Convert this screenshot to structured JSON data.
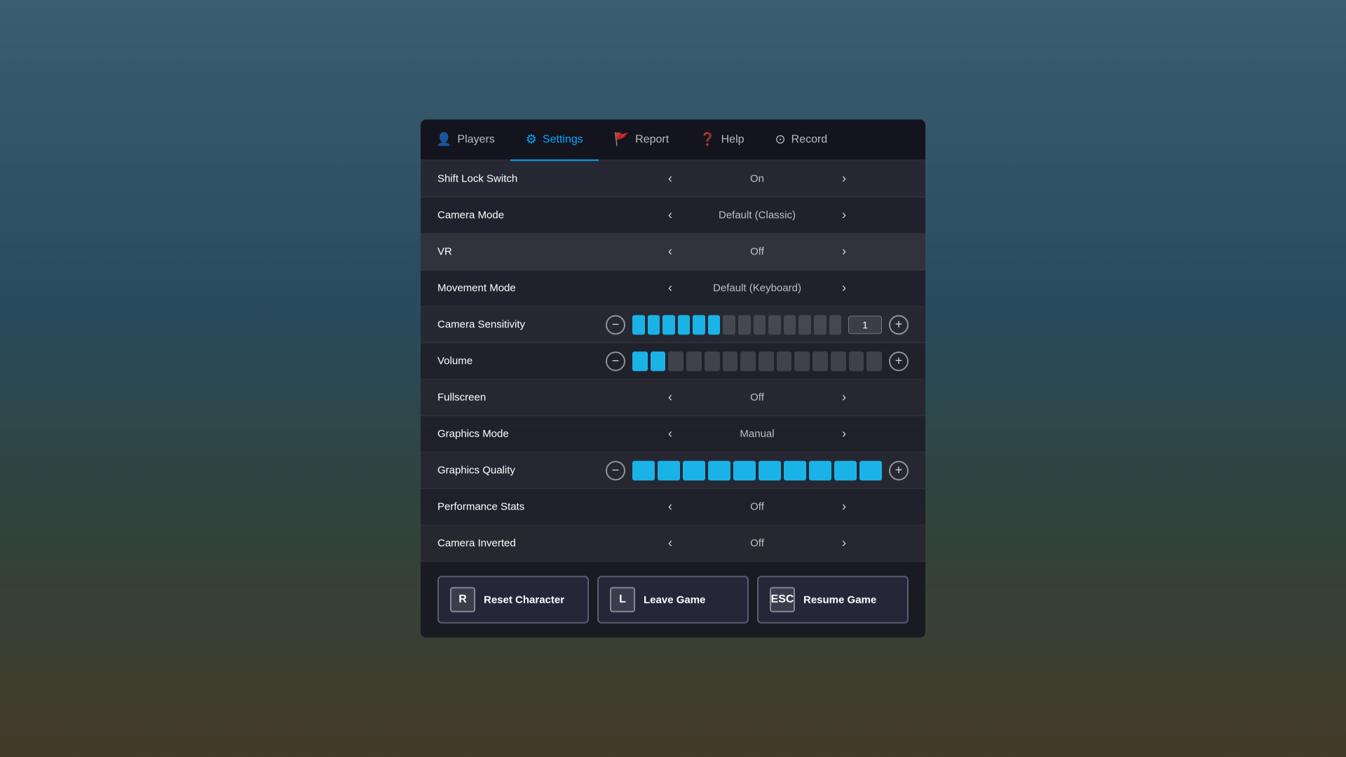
{
  "background": {
    "color": "#4a7a9b"
  },
  "tabs": [
    {
      "id": "players",
      "label": "Players",
      "icon": "👤",
      "active": false
    },
    {
      "id": "settings",
      "label": "Settings",
      "icon": "⚙",
      "active": true
    },
    {
      "id": "report",
      "label": "Report",
      "icon": "🚩",
      "active": false
    },
    {
      "id": "help",
      "label": "Help",
      "icon": "❓",
      "active": false
    },
    {
      "id": "record",
      "label": "Record",
      "icon": "⊙",
      "active": false
    }
  ],
  "settings": [
    {
      "id": "shift-lock-switch",
      "label": "Shift Lock Switch",
      "type": "toggle",
      "value": "On"
    },
    {
      "id": "camera-mode",
      "label": "Camera Mode",
      "type": "toggle",
      "value": "Default (Classic)"
    },
    {
      "id": "vr",
      "label": "VR",
      "type": "toggle",
      "value": "Off",
      "highlighted": true
    },
    {
      "id": "movement-mode",
      "label": "Movement Mode",
      "type": "toggle",
      "value": "Default (Keyboard)"
    },
    {
      "id": "camera-sensitivity",
      "label": "Camera Sensitivity",
      "type": "slider",
      "filledBars": 6,
      "totalBars": 14,
      "inputValue": "1"
    },
    {
      "id": "volume",
      "label": "Volume",
      "type": "slider",
      "filledBars": 2,
      "totalBars": 14,
      "inputValue": null
    },
    {
      "id": "fullscreen",
      "label": "Fullscreen",
      "type": "toggle",
      "value": "Off"
    },
    {
      "id": "graphics-mode",
      "label": "Graphics Mode",
      "type": "toggle",
      "value": "Manual"
    },
    {
      "id": "graphics-quality",
      "label": "Graphics Quality",
      "type": "slider",
      "filledBars": 10,
      "totalBars": 10,
      "inputValue": null
    },
    {
      "id": "performance-stats",
      "label": "Performance Stats",
      "type": "toggle",
      "value": "Off"
    },
    {
      "id": "camera-inverted",
      "label": "Camera Inverted",
      "type": "toggle",
      "value": "Off"
    }
  ],
  "buttons": [
    {
      "id": "reset-character",
      "key": "R",
      "label": "Reset Character"
    },
    {
      "id": "leave-game",
      "key": "L",
      "label": "Leave Game"
    },
    {
      "id": "resume-game",
      "key": "ESC",
      "label": "Resume Game"
    }
  ]
}
